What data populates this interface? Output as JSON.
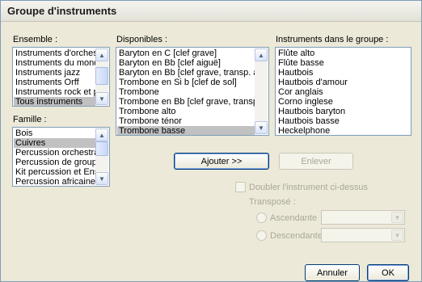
{
  "window": {
    "title": "Groupe d'instruments"
  },
  "ensemble": {
    "label": "Ensemble :",
    "items": [
      "Instruments d'orchestre",
      "Instruments du monde",
      "Instruments jazz",
      "Instruments Orff",
      "Instruments rock et pop",
      "Tous instruments"
    ],
    "selected_index": 5
  },
  "famille": {
    "label": "Famille :",
    "items": [
      "Bois",
      "Cuivres",
      "Percussion orchestrale",
      "Percussion de groupe",
      "Kit percussion et Ensemble",
      "Percussion africaine"
    ],
    "selected_index": 1
  },
  "disponibles": {
    "label": "Disponibles :",
    "items": [
      "Baryton en C [clef grave]",
      "Baryton en Bb [clef aiguë]",
      "Baryton en Bb [clef grave, transp. aiguë]",
      "Trombone en Si b [clef de sol]",
      "Trombone",
      "Trombone en Bb [clef grave, transp. aigu",
      "Trombone alto",
      "Trombone ténor",
      "Trombone basse"
    ],
    "selected_index": 8
  },
  "groupe": {
    "label": "Instruments dans le groupe :",
    "items": [
      "Flûte alto",
      "Flûte basse",
      "Hautbois",
      "Hautbois d'amour",
      "Cor anglais",
      "Corno inglese",
      "Hautbois baryton",
      "Hautbois basse",
      "Heckelphone"
    ]
  },
  "buttons": {
    "add": "Ajouter >>",
    "remove": "Enlever",
    "cancel": "Annuler",
    "ok": "OK"
  },
  "options": {
    "double_label": "Doubler l'instrument ci-dessus",
    "transpose_label": "Transposé :",
    "ascending_label": "Ascendante",
    "descending_label": "Descendante"
  },
  "icons": {
    "scroll_up": "▲",
    "scroll_down": "▼",
    "combo_arrow": "▼"
  }
}
